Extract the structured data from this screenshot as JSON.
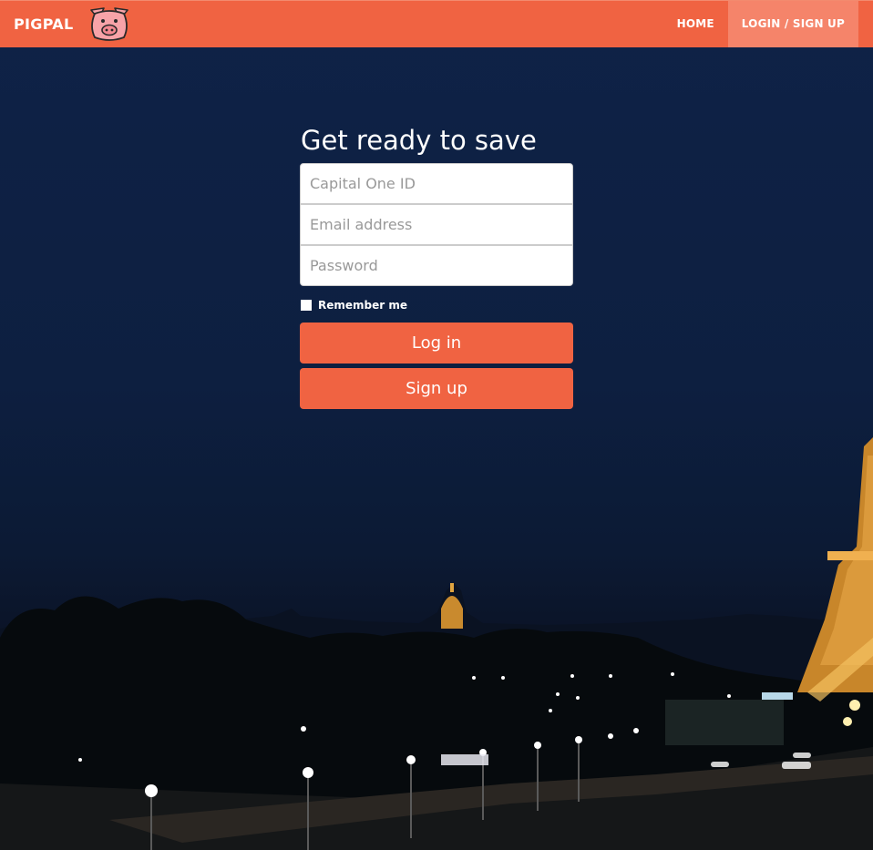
{
  "navbar": {
    "brand": "PIGPAL",
    "logo_icon": "pig-face-icon",
    "links": [
      {
        "label": "HOME",
        "active": false
      },
      {
        "label": "LOGIN / SIGN UP",
        "active": true
      }
    ],
    "accent_color": "#f06342"
  },
  "form": {
    "heading": "Get ready to save",
    "fields": {
      "capital_one_id": {
        "placeholder": "Capital One ID",
        "value": ""
      },
      "email": {
        "placeholder": "Email address",
        "value": ""
      },
      "password": {
        "placeholder": "Password",
        "value": ""
      }
    },
    "remember_me": {
      "label": "Remember me",
      "checked": false
    },
    "login_label": "Log in",
    "signup_label": "Sign up"
  },
  "background": {
    "scene": "night-city-eiffel-tower"
  }
}
